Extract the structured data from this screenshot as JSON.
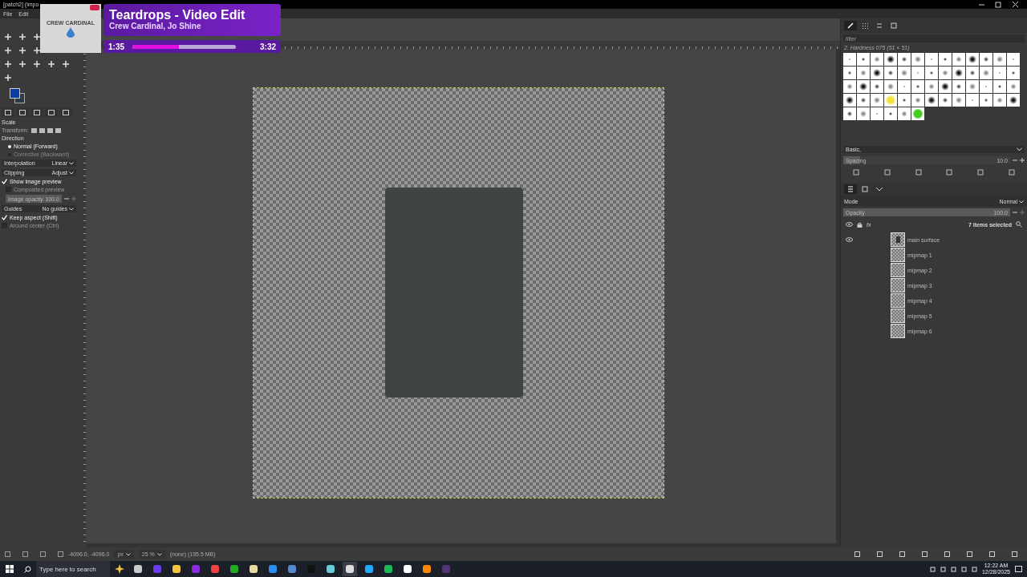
{
  "window": {
    "title": "[patch2] (impo"
  },
  "menu": [
    "File",
    "Edit"
  ],
  "now_playing": {
    "art_text": "CREW CARDINAL",
    "title": "Teardrops - Video Edit",
    "artist": "Crew Cardinal, Jo Shine",
    "elapsed": "1:35",
    "duration": "3:32",
    "level": 0.45
  },
  "tool_options": [
    {
      "kind": "heading",
      "label": "Scale"
    },
    {
      "kind": "transform",
      "label": "Transform:"
    },
    {
      "kind": "heading",
      "label": "Direction"
    },
    {
      "kind": "radio",
      "label": "Normal (Forward)",
      "selected": true
    },
    {
      "kind": "radio",
      "label": "Corrective (Backward)",
      "selected": false
    },
    {
      "kind": "dropdown",
      "label": "Interpolation",
      "value": "Linear"
    },
    {
      "kind": "dropdown",
      "label": "Clipping",
      "value": "Adjust"
    },
    {
      "kind": "check",
      "label": "Show image preview",
      "checked": true
    },
    {
      "kind": "check",
      "label": "Composited preview",
      "checked": false
    },
    {
      "kind": "slider",
      "label": "Image opacity",
      "value": "100.0",
      "level": 1
    },
    {
      "kind": "dropdown",
      "label": "Guides",
      "value": "No guides"
    },
    {
      "kind": "check",
      "label": "Keep aspect (Shift)",
      "checked": true
    },
    {
      "kind": "check",
      "label": "Around center (Ctrl)",
      "checked": false
    }
  ],
  "brushes": {
    "filter_placeholder": "filter",
    "current": "2. Hardness 075 (51 × 51)",
    "tag": "Basic,",
    "spacing": {
      "label": "Spacing",
      "value": "10.0",
      "level": 0.1
    }
  },
  "layers": {
    "mode_label": "Mode",
    "mode": "Normal",
    "opacity": {
      "label": "Opacity",
      "value": "100.0",
      "level": 1
    },
    "effects_label": "fx",
    "selection": "7 items selected",
    "items": [
      {
        "name": "main surface",
        "visible": true
      },
      {
        "name": "mipmap 1",
        "visible": false
      },
      {
        "name": "mipmap 2",
        "visible": false
      },
      {
        "name": "mipmap 3",
        "visible": false
      },
      {
        "name": "mipmap 4",
        "visible": false
      },
      {
        "name": "mipmap 5",
        "visible": false
      },
      {
        "name": "mipmap 6",
        "visible": false
      }
    ]
  },
  "status": {
    "coords": "-4096.0, -4096.0",
    "unit": "px",
    "zoom": "25 %",
    "info": "(none) (195.5 MB)"
  },
  "taskbar": {
    "search_placeholder": "Type here to search",
    "time": "12:22 AM",
    "date": "12/28/2025"
  }
}
